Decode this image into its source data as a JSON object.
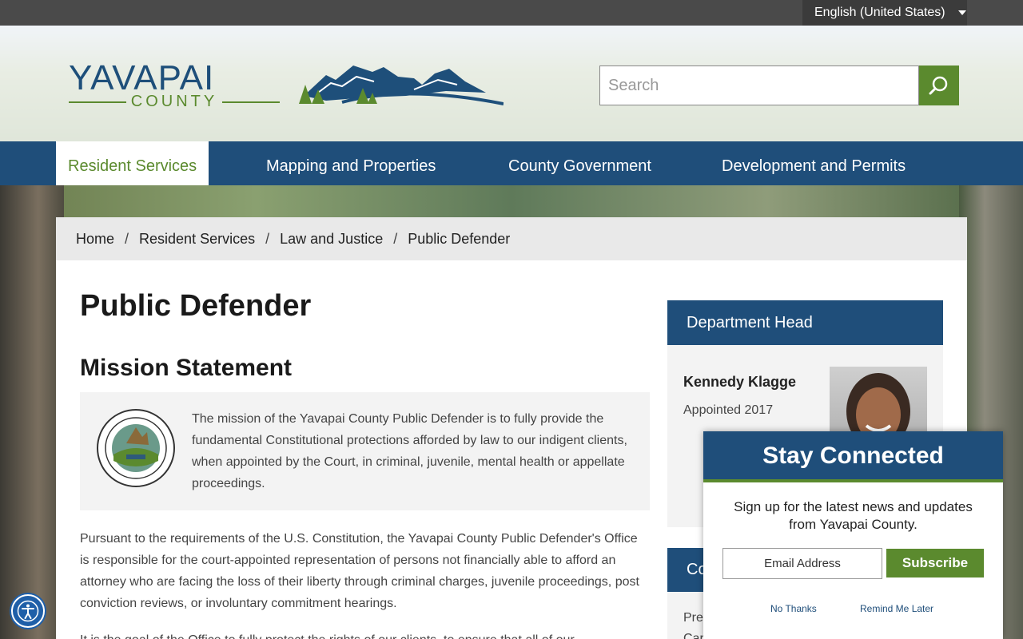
{
  "topbar": {
    "language": "English (United States)"
  },
  "logo": {
    "word": "YAVAPAI",
    "sub": "COUNTY"
  },
  "search": {
    "placeholder": "Search"
  },
  "nav": {
    "items": [
      {
        "label": "Resident Services"
      },
      {
        "label": "Mapping and Properties"
      },
      {
        "label": "County Government"
      },
      {
        "label": "Development and Permits"
      }
    ]
  },
  "breadcrumb": {
    "items": [
      "Home",
      "Resident Services",
      "Law and Justice",
      "Public Defender"
    ],
    "separator": "/"
  },
  "main": {
    "title": "Public Defender",
    "mission_heading": "Mission Statement",
    "mission_text": "The mission of the Yavapai County Public Defender is to fully provide the fundamental Constitutional protections afforded by law to our indigent clients, when appointed by the Court, in criminal, juvenile, mental health or appellate proceedings.",
    "paragraph1": "Pursuant to the requirements of the U.S. Constitution, the Yavapai County Public Defender's Office is responsible for the court-appointed representation of persons not financially able to afford an attorney who are facing the loss of their liberty through criminal charges, juvenile proceedings, post conviction reviews, or involuntary commitment hearings.",
    "paragraph2": "It is the goal of the Office to fully protect the rights of our clients, to ensure that all of our"
  },
  "department_head": {
    "heading": "Department Head",
    "name": "Kennedy Klagge",
    "appointed": "Appointed 2017"
  },
  "contact": {
    "heading": "Co",
    "line1": "Pres",
    "line2": "Carr"
  },
  "popup": {
    "title": "Stay Connected",
    "message": "Sign up for the latest news and updates from Yavapai County.",
    "email_placeholder": "Email Address",
    "subscribe_label": "Subscribe",
    "no_thanks": "No Thanks",
    "remind_later": "Remind Me Later"
  },
  "colors": {
    "brand_blue": "#1f4e7a",
    "brand_green": "#5b8a2e"
  }
}
